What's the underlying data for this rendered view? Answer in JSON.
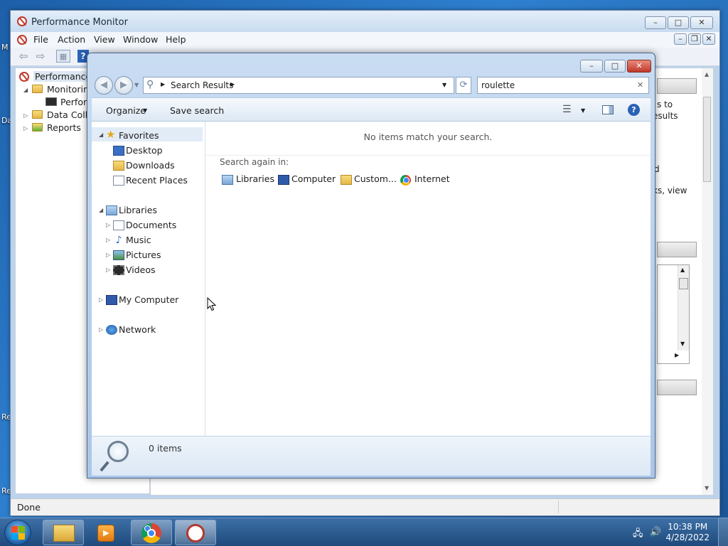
{
  "desktop": {
    "label_fragments": [
      "M",
      "Da",
      "Re",
      "Re"
    ]
  },
  "perfmon": {
    "title": "Performance Monitor",
    "menu": [
      "File",
      "Action",
      "View",
      "Window",
      "Help"
    ],
    "tree": {
      "root": "Performance",
      "monitoring": "Monitoring",
      "perf": "Perform",
      "data_collector": "Data Collec",
      "reports": "Reports"
    },
    "right_text": [
      "s to",
      "esults",
      "d",
      "ks, view"
    ],
    "status": "Done",
    "caption": {
      "min": "–",
      "max": "□",
      "close": "✕"
    },
    "inner_caption": {
      "min": "–",
      "restore": "❐",
      "close": "✕"
    }
  },
  "explorer": {
    "breadcrumb": "Search Results",
    "search_value": "roulette",
    "search_clear": "✕",
    "commands": {
      "organize": "Organize",
      "save_search": "Save search"
    },
    "nav": {
      "favorites": "Favorites",
      "desktop": "Desktop",
      "downloads": "Downloads",
      "recent": "Recent Places",
      "libraries": "Libraries",
      "documents": "Documents",
      "music": "Music",
      "pictures": "Pictures",
      "videos": "Videos",
      "computer": "My Computer",
      "network": "Network"
    },
    "empty_message": "No items match your search.",
    "search_again": "Search again in:",
    "search_locations": [
      "Libraries",
      "Computer",
      "Custom...",
      "Internet"
    ],
    "item_count": "0 items",
    "caption": {
      "min": "–",
      "max": "□",
      "close": "✕"
    }
  },
  "taskbar": {
    "time": "10:38 PM",
    "date": "4/28/2022"
  }
}
